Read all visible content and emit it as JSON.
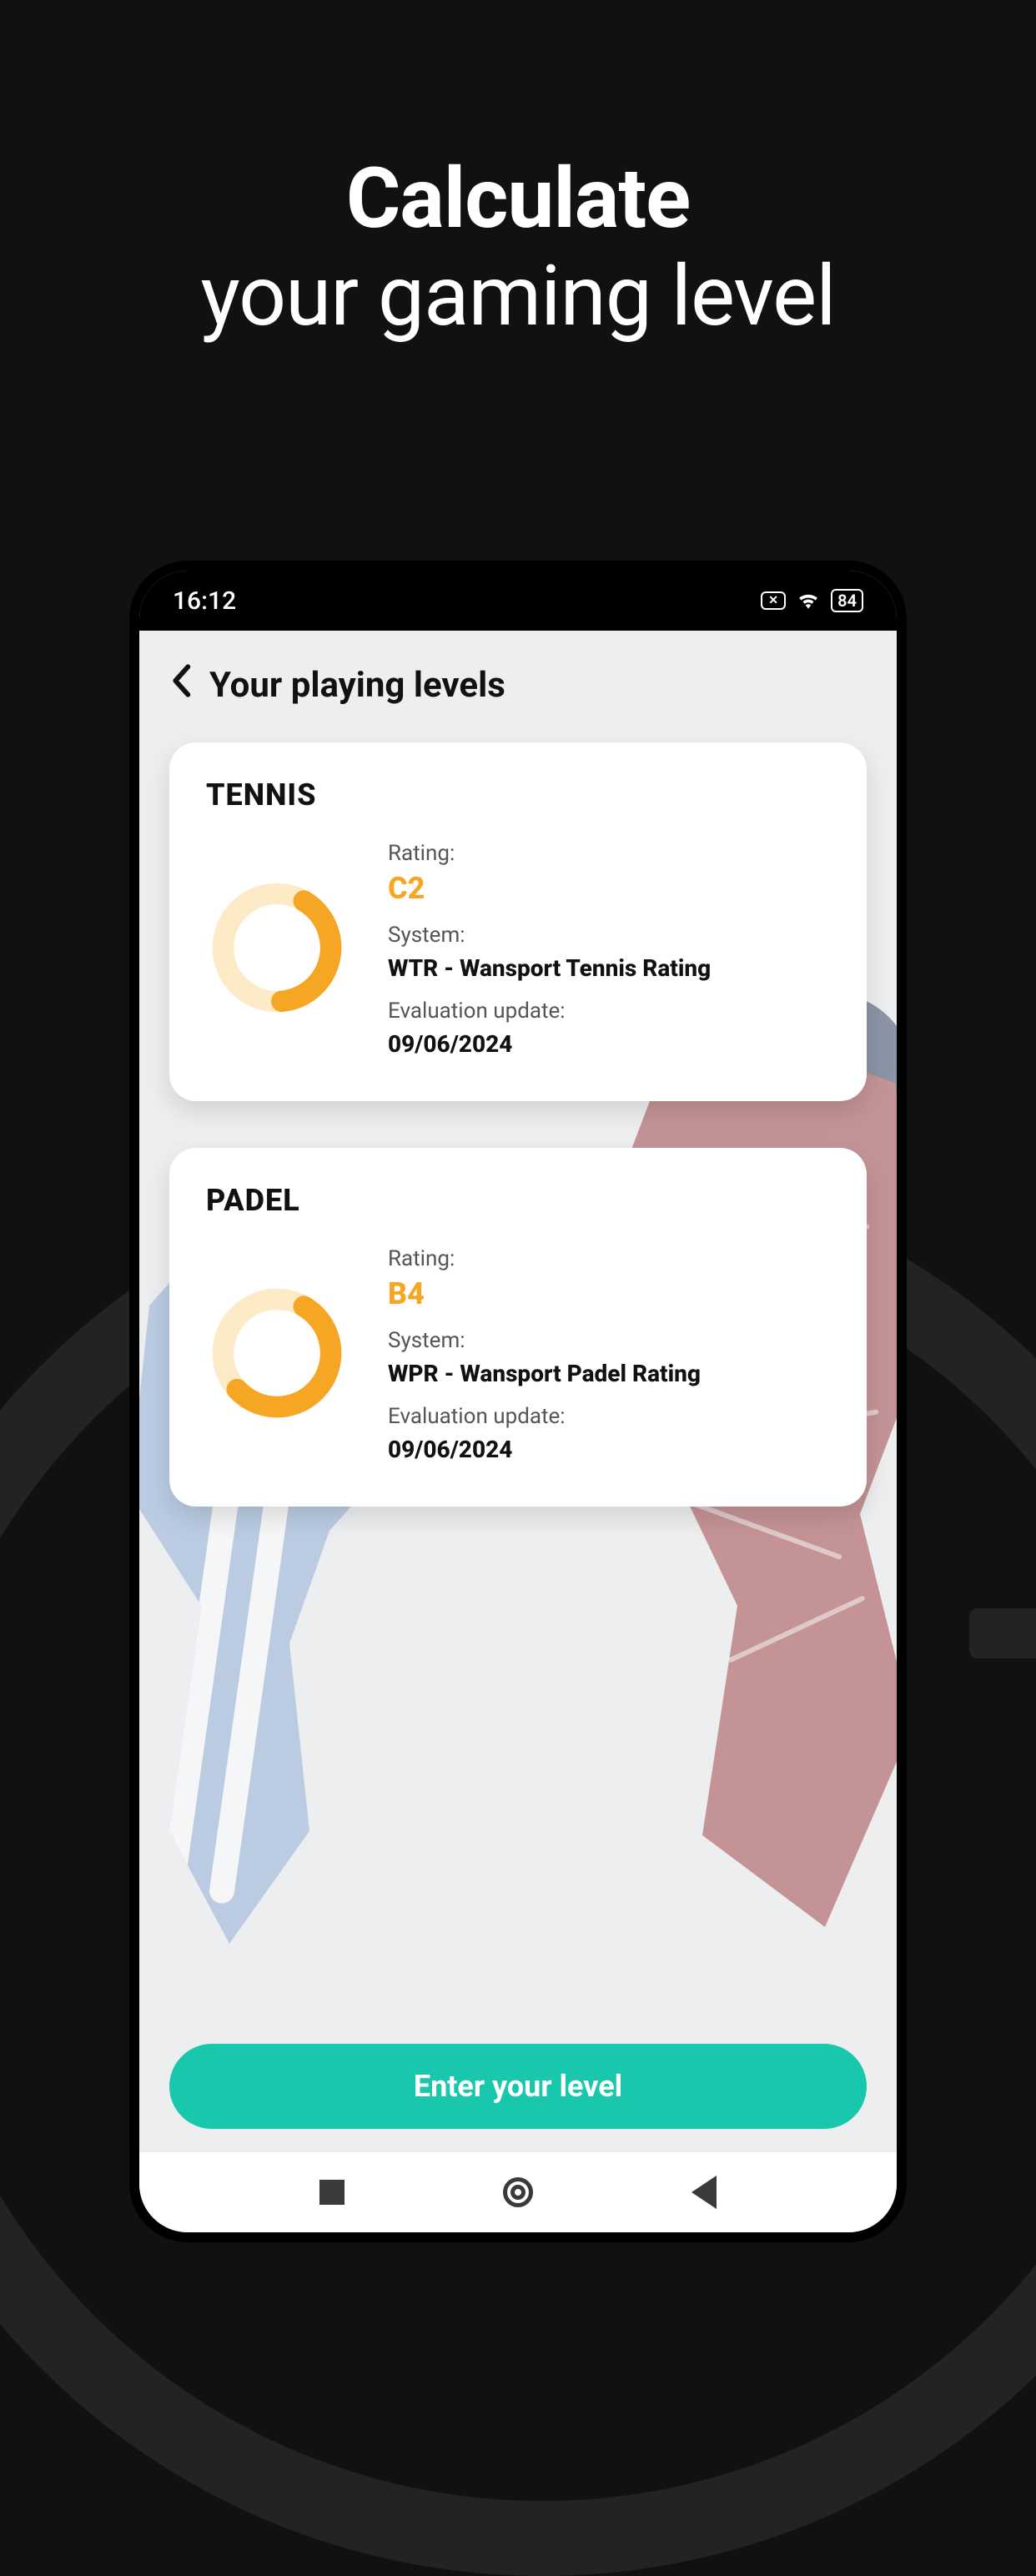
{
  "marketing": {
    "line1": "Calculate",
    "line2": "your gaming level"
  },
  "statusbar": {
    "time": "16:12",
    "battery": "84"
  },
  "app": {
    "title": "Your playing levels",
    "cta_label": "Enter your level",
    "cards": [
      {
        "sport": "TENNIS",
        "rating_label": "Rating:",
        "rating_value": "C2",
        "system_label": "System:",
        "system_value": "WTR - Wansport Tennis Rating",
        "update_label": "Evaluation update:",
        "update_value": "09/06/2024",
        "ring_percent": 40
      },
      {
        "sport": "PADEL",
        "rating_label": "Rating:",
        "rating_value": "B4",
        "system_label": "System:",
        "system_value": "WPR - Wansport Padel Rating",
        "update_label": "Evaluation update:",
        "update_value": "09/06/2024",
        "ring_percent": 55
      }
    ]
  },
  "colors": {
    "accent_orange": "#f5a623",
    "ring_track": "#fdebc8",
    "cta": "#19c7ad"
  }
}
